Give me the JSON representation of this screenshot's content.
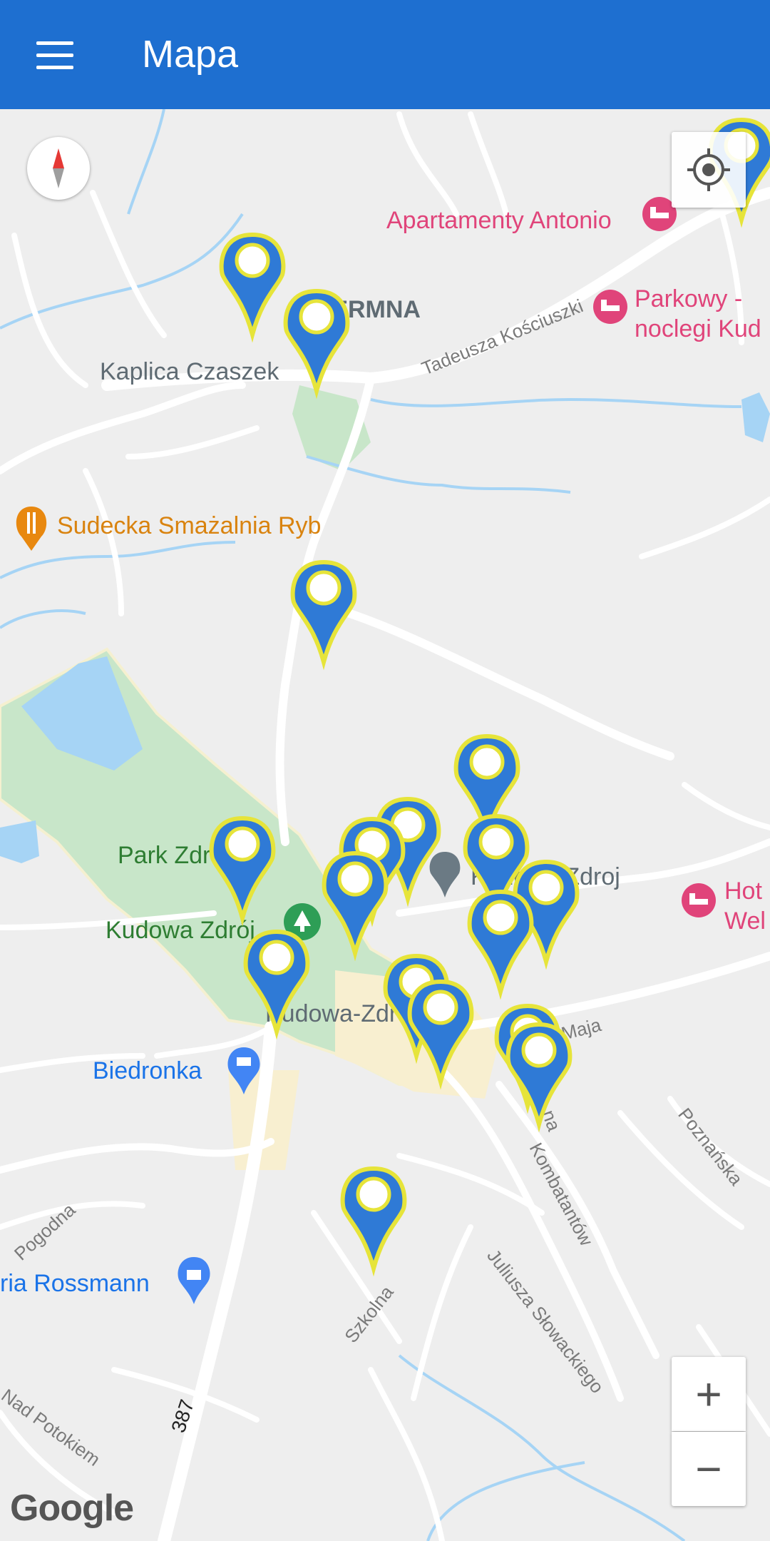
{
  "appbar": {
    "title": "Mapa",
    "color": "#1e6fd0"
  },
  "map": {
    "places": {
      "apartamenty": "Apartamenty Antonio",
      "parkowy_1": "Parkowy -",
      "parkowy_2": "noclegi Kud",
      "czermna": "CZERMNA",
      "kaplica": "Kaplica Czaszek",
      "smazalnia": "Sudecka Smażalnia Ryb",
      "park": "Park Zdrojowy",
      "kudowa_zdroj_park": "Kudowa Zdrój",
      "kudowa_zdroj_town": "Kudowa Zdroj",
      "kudowa_center": "Kudowa-Zdrój",
      "hotel_1": "Hot",
      "hotel_2": "Wel",
      "biedronka": "Biedronka",
      "rossmann": "ria Rossmann"
    },
    "streets": {
      "koscuszki": "Tadeusza Kościuszki",
      "maja": "Maja",
      "kombatantow": "Kombatantów",
      "slowackiego": "Juliusza Słowackiego",
      "poznanska": "Poznańska",
      "szkolna": "Szkolna",
      "pogodna": "Pogodna",
      "nad_potokiem": "Nad Potokiem",
      "route": "387",
      "na": "na"
    },
    "marker_count": 18,
    "colors": {
      "marker_fill": "#2f7ad6",
      "marker_ring": "#e6e43a",
      "lodging": "#e0447a",
      "food": "#e8880f",
      "park_green": "#c8e6c9",
      "water": "#a6d4f5",
      "text_dark": "#5f6b73"
    }
  },
  "controls": {
    "zoom_in": "+",
    "zoom_out": "−",
    "google": "Google"
  },
  "icons": {
    "menu": "hamburger-menu-icon",
    "compass": "compass-icon",
    "locate": "my-location-icon",
    "lodging": "bed-icon",
    "food": "fork-knife-icon",
    "shop": "cart-icon",
    "pharmacy": "bag-icon",
    "tree": "tree-icon"
  }
}
